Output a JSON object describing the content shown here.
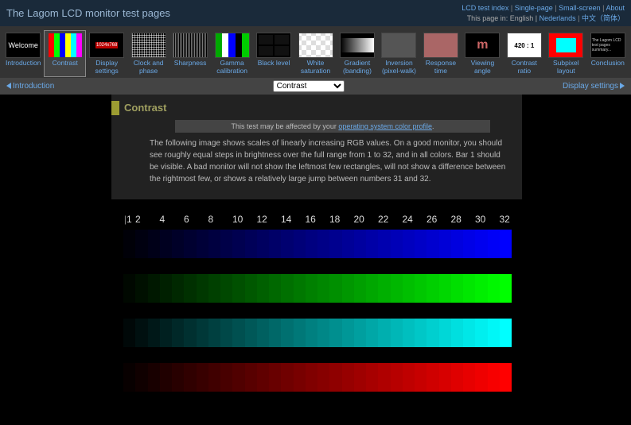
{
  "header": {
    "title": "The Lagom LCD monitor test pages",
    "links": {
      "index": "LCD test index",
      "single": "Single-page",
      "small": "Small-screen",
      "about": "About"
    },
    "lang_label": "This page in: English |",
    "lang_nl": "Nederlands",
    "lang_zh": "中文（简体）"
  },
  "nav": {
    "items": [
      {
        "label": "Introduction"
      },
      {
        "label": "Contrast"
      },
      {
        "label": "Display settings"
      },
      {
        "label": "Clock and phase"
      },
      {
        "label": "Sharpness"
      },
      {
        "label": "Gamma calibration"
      },
      {
        "label": "Black level"
      },
      {
        "label": "White saturation"
      },
      {
        "label": "Gradient (banding)"
      },
      {
        "label": "Inversion (pixel-walk)"
      },
      {
        "label": "Response time"
      },
      {
        "label": "Viewing angle"
      },
      {
        "label": "Contrast ratio"
      },
      {
        "label": "Subpixel layout"
      },
      {
        "label": "Conclusion"
      }
    ],
    "welcome_text": "Welcome",
    "res_text": "1024x768",
    "cr_text": "420 : 1"
  },
  "subnav": {
    "prev": "Introduction",
    "next": "Display settings",
    "select_value": "Contrast"
  },
  "page": {
    "title": "Contrast",
    "notice_pre": "This test may be affected by your ",
    "notice_link": "operating system color profile",
    "body": "The following image shows scales of linearly increasing RGB values. On a good monitor, you should see roughly equal steps in brightness over the full range from 1 to 32, and in all colors. Bar 1 should be visible. A bad monitor will not show the leftmost few rectangles, will not show a difference between the rightmost few, or shows a relatively large jump between numbers 31 and 32."
  },
  "ticks": [
    "1",
    "2",
    "",
    "4",
    "",
    "6",
    "",
    "8",
    "",
    "10",
    "",
    "12",
    "",
    "14",
    "",
    "16",
    "",
    "18",
    "",
    "20",
    "",
    "22",
    "",
    "24",
    "",
    "26",
    "",
    "28",
    "",
    "30",
    "",
    "32"
  ],
  "chart_data": {
    "type": "bar",
    "bars": [
      {
        "color": "blue",
        "channel": "#0000FF"
      },
      {
        "color": "green",
        "channel": "#00FF00"
      },
      {
        "color": "cyan",
        "channel": "#00FFFF"
      },
      {
        "color": "red",
        "channel": "#FF0000"
      }
    ],
    "steps": 32,
    "value_range": [
      1,
      32
    ],
    "description": "Each bar is 32 segments of linearly increasing RGB intensity from ~0 to 255 on the indicated channel(s)."
  }
}
